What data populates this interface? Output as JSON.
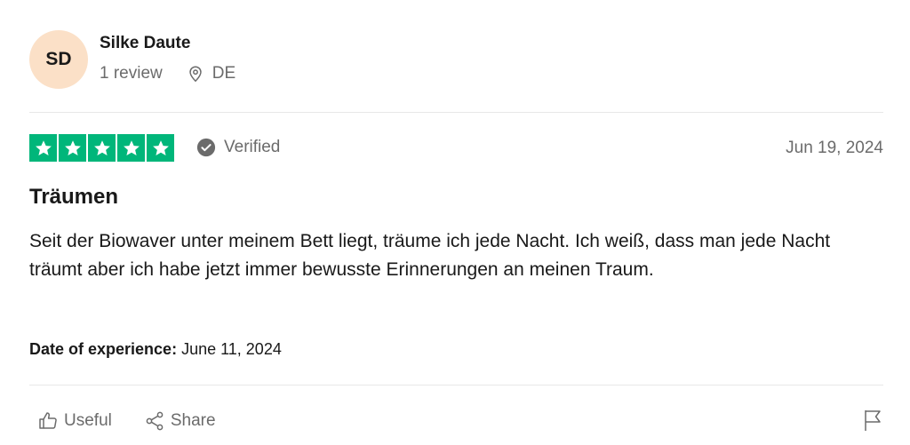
{
  "author": {
    "initials": "SD",
    "name": "Silke Daute",
    "review_count": "1 review",
    "country": "DE"
  },
  "review": {
    "rating": 5,
    "verified_label": "Verified",
    "date": "Jun 19, 2024",
    "title": "Träumen",
    "body": "Seit der Biowaver unter meinem Bett liegt, träume ich jede Nacht. Ich weiß, dass man jede Nacht träumt aber ich habe jetzt immer bewusste Erinnerungen an meinen Traum.",
    "experience_label": "Date of experience:",
    "experience_date": "June 11, 2024"
  },
  "actions": {
    "useful_label": "Useful",
    "share_label": "Share"
  },
  "colors": {
    "star_green": "#00b67a",
    "avatar_bg": "#fbe0c7",
    "muted_text": "#6b6b6b"
  },
  "icons": {
    "location": "map-pin-icon",
    "verified": "check-circle-icon",
    "useful": "thumbs-up-icon",
    "share": "share-icon",
    "report": "flag-icon"
  }
}
